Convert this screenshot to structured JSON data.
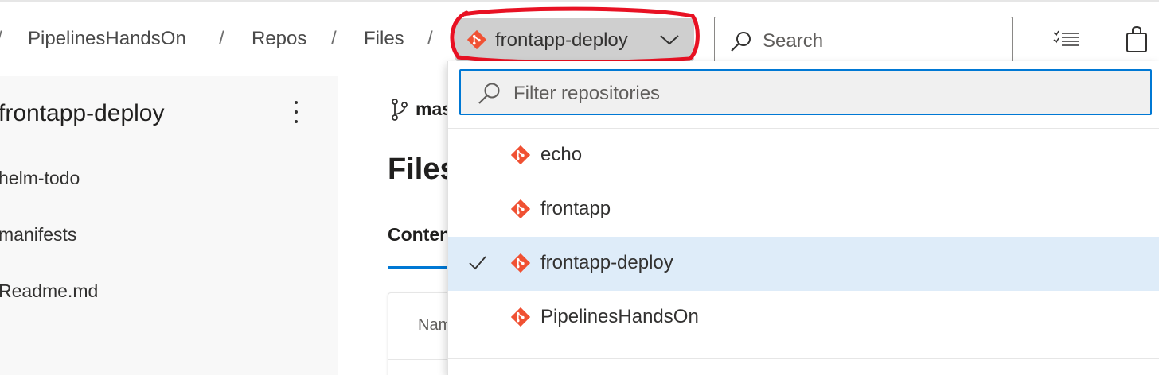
{
  "breadcrumb": {
    "items": [
      "PipelinesHandsOn",
      "Repos",
      "Files"
    ],
    "separator": "/"
  },
  "repo_picker": {
    "selected": "frontapp-deploy",
    "icon": "git-repo-icon",
    "chevron": "chevron-down-icon"
  },
  "search": {
    "placeholder": "Search"
  },
  "header_icons": [
    "list-icon",
    "shopping-bag-icon"
  ],
  "sidebar": {
    "repo_title": "frontapp-deploy",
    "items": [
      {
        "label": "helm-todo"
      },
      {
        "label": "manifests"
      },
      {
        "label": "Readme.md"
      }
    ]
  },
  "main": {
    "branch": "master",
    "title": "Files",
    "tab": "Contents",
    "column_name": "Name"
  },
  "dropdown": {
    "filter_placeholder": "Filter repositories",
    "items": [
      {
        "label": "echo",
        "selected": false
      },
      {
        "label": "frontapp",
        "selected": false
      },
      {
        "label": "frontapp-deploy",
        "selected": true
      },
      {
        "label": "PipelinesHandsOn",
        "selected": false
      }
    ]
  },
  "colors": {
    "git_orange": "#f05133",
    "accent": "#0078d4",
    "selected_bg": "#deecf9",
    "annotation_red": "#e81123"
  }
}
